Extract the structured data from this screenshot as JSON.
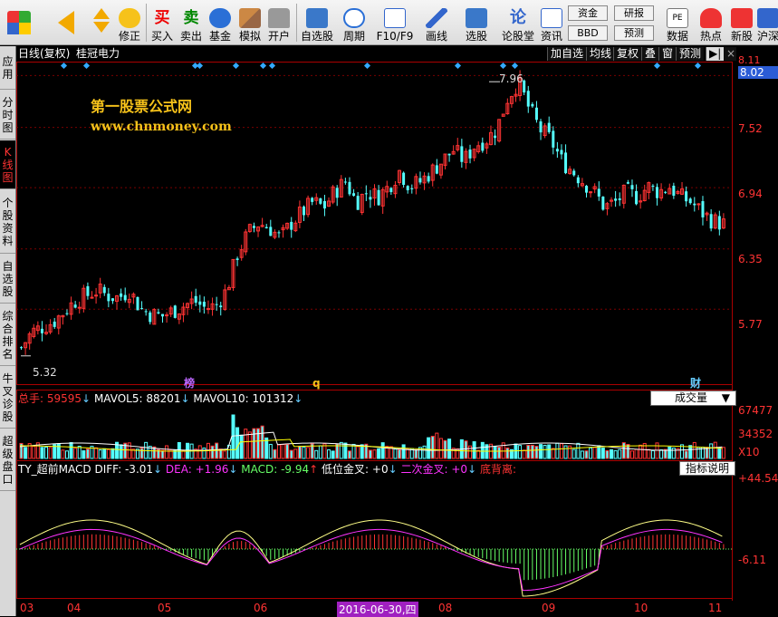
{
  "toolbar": {
    "buttons": [
      {
        "id": "back",
        "label": ""
      },
      {
        "id": "updown",
        "label": ""
      },
      {
        "id": "fix",
        "label": "修正"
      },
      {
        "id": "buy",
        "label": "买入"
      },
      {
        "id": "sell",
        "label": "卖出"
      },
      {
        "id": "fund",
        "label": "基金"
      },
      {
        "id": "sim",
        "label": "模拟"
      },
      {
        "id": "open",
        "label": "开户"
      },
      {
        "id": "watch",
        "label": "自选股"
      },
      {
        "id": "period",
        "label": "周期"
      },
      {
        "id": "f10",
        "label": "F10/F9"
      },
      {
        "id": "draw",
        "label": "画线"
      },
      {
        "id": "pick",
        "label": "选股"
      },
      {
        "id": "forum",
        "label": "论股堂"
      },
      {
        "id": "info",
        "label": "资讯"
      },
      {
        "id": "data",
        "label": "数据"
      },
      {
        "id": "hot",
        "label": "热点"
      },
      {
        "id": "newstock",
        "label": "新股"
      },
      {
        "id": "hk",
        "label": "沪深"
      }
    ],
    "small_buttons": {
      "zijin": "资金",
      "bbd": "BBD",
      "yanbao": "研报",
      "yuce": "预测",
      "pe": "PE"
    }
  },
  "sidebar": [
    "应用",
    "分时图",
    "K线图",
    "个股资料",
    "自选股",
    "综合排名",
    "牛叉诊股",
    "超级盘口"
  ],
  "infobar": {
    "chart_type": "日线(复权)",
    "stock_name": "桂冠电力",
    "buttons": [
      "加自选",
      "均线",
      "复权",
      "叠",
      "窗",
      "预测"
    ]
  },
  "price_axis": {
    "top": "8.11",
    "current": "8.02",
    "ticks": [
      "7.52",
      "6.94",
      "6.35",
      "5.77"
    ]
  },
  "annotations": {
    "high": "7.96",
    "low": "5.32",
    "mark1": "榜",
    "mark2": "q",
    "mark3": "财"
  },
  "watermark": {
    "line1": "第一股票公式网",
    "line2": "www.chnmoney.com"
  },
  "volume": {
    "label_total": "总手: 59595",
    "label_mavol5": "MAVOL5: 88201",
    "label_mavol10": "MAVOL10: 101312",
    "select": "成交量",
    "axis": [
      "67477",
      "34352",
      "X10"
    ]
  },
  "macd": {
    "name": "TY_超前MACD",
    "diff": "DIFF: -3.01",
    "dea": "DEA: +1.96",
    "macd": "MACD: -9.94",
    "low_cross": "低位金叉: +0",
    "second_cross": "二次金叉: +0",
    "bottom_div": "底背离: ",
    "help": "指标说明",
    "axis_top": "+44.54",
    "axis_mid": "-6.11"
  },
  "time_axis": {
    "months": [
      "03",
      "04",
      "05",
      "06",
      "07",
      "08",
      "09",
      "10",
      "11"
    ],
    "cursor_date": "2016-06-30,四"
  },
  "chart_data": {
    "type": "candlestick",
    "title": "桂冠电力 日线(复权)",
    "price_ylim": [
      5.1,
      8.11
    ],
    "price_ticks": [
      5.77,
      6.35,
      6.94,
      7.52,
      8.02
    ],
    "high_point": 7.96,
    "low_point": 5.32,
    "last_close": 6.59,
    "close_path": [
      5.4,
      5.55,
      5.6,
      5.65,
      5.75,
      5.85,
      5.9,
      5.95,
      5.9,
      5.88,
      5.95,
      5.78,
      5.72,
      5.7,
      5.75,
      5.8,
      5.85,
      5.78,
      5.8,
      5.95,
      6.3,
      6.5,
      6.6,
      6.55,
      6.45,
      6.6,
      6.7,
      6.8,
      6.75,
      6.9,
      7.0,
      6.8,
      6.9,
      6.85,
      6.95,
      7.1,
      6.95,
      7.0,
      7.1,
      7.2,
      7.3,
      7.2,
      7.35,
      7.4,
      7.5,
      7.8,
      7.96,
      7.7,
      7.5,
      7.4,
      7.2,
      7.1,
      7.0,
      6.9,
      6.75,
      6.8,
      6.9,
      6.85,
      6.95,
      6.9,
      6.95,
      6.85,
      6.8,
      6.7,
      6.62,
      6.59
    ],
    "volume_axis": [
      34352,
      67477
    ],
    "macd_axis": [
      -6.11,
      44.54
    ]
  }
}
